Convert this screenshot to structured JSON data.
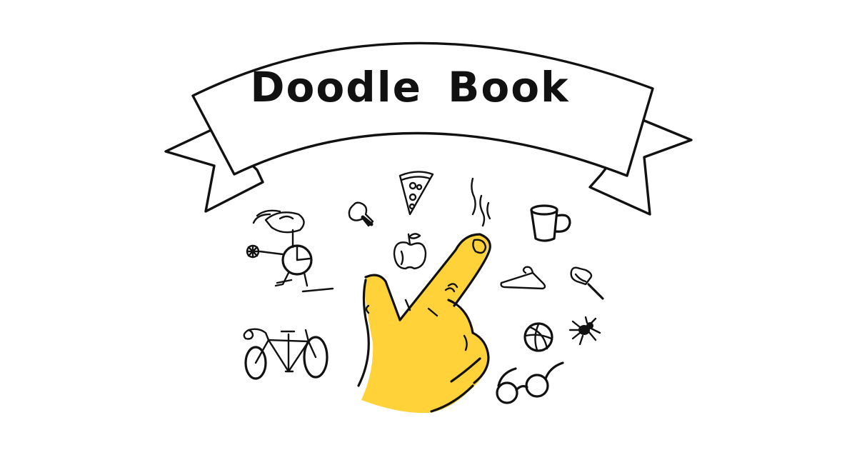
{
  "banner": {
    "title": "Doodle Book"
  },
  "colors": {
    "ink": "#111111",
    "hand": "#ffd23a",
    "background": "#ffffff"
  },
  "doodles": [
    "lightbulb-icon",
    "pizza-slice-icon",
    "apple-icon",
    "steam-icon",
    "mug-icon",
    "hanger-icon",
    "push-pin-icon",
    "basketball-icon",
    "spider-icon",
    "glasses-icon",
    "bicycle-icon",
    "unicycle-rider-icon",
    "pointing-hand-icon"
  ]
}
